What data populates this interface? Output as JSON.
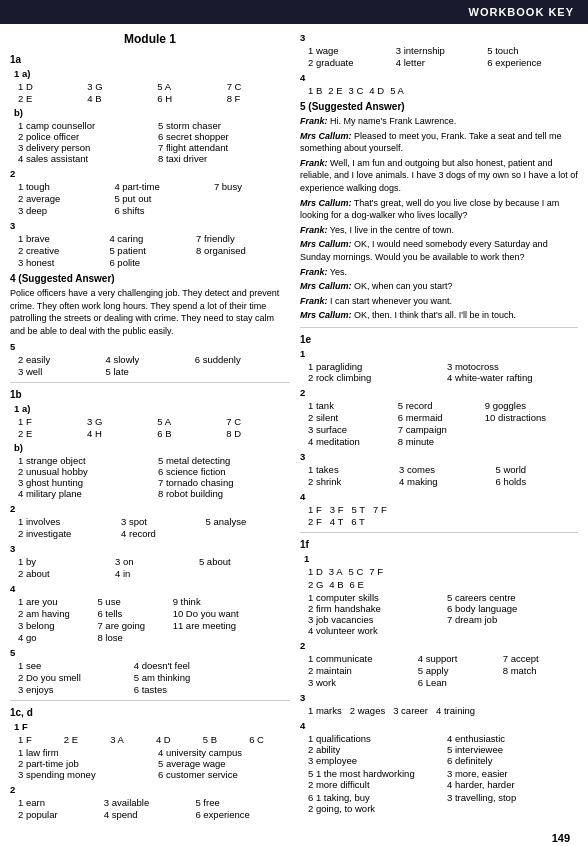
{
  "header": {
    "title": "WORKBOOK KEY"
  },
  "page_number": "149",
  "module": {
    "title": "Module 1"
  },
  "sections": {
    "1a": {
      "label": "1a",
      "q1": {
        "a": [
          "1 D",
          "3 G",
          "5 A",
          "7 C",
          "2 E",
          "4 B",
          "6 H",
          "8 F"
        ],
        "b": [
          "1 camp counsellor",
          "5 storm chaser",
          "2 police officer",
          "6 secret shopper",
          "3 delivery person",
          "7 flight attendant",
          "4 sales assistant",
          "8 taxi driver"
        ]
      },
      "q2": [
        "1 tough",
        "4 part-time",
        "7 busy",
        "2 average",
        "5 put out",
        "3 deep",
        "6 shifts"
      ],
      "q3": [
        "1 brave",
        "4 caring",
        "7 friendly",
        "2 creative",
        "5 patient",
        "8 organised",
        "3 honest",
        "6 polite"
      ],
      "q4_suggested": {
        "label": "4 (Suggested Answer)",
        "text": "Police officers have a very challenging job. They detect and prevent crime. They often work long hours. They spend a lot of their time patrolling the streets or dealing with crime. They need to stay calm and be able to deal with the public easily."
      },
      "q5": [
        "2 easily",
        "4 slowly",
        "6 suddenly",
        "3 well",
        "5 late"
      ]
    },
    "1b": {
      "label": "1b",
      "q1": {
        "a": [
          "1 F",
          "3 G",
          "5 A",
          "7 C",
          "2 E",
          "4 H",
          "6 B",
          "8 D"
        ],
        "b": [
          "1 strange object",
          "5 metal detecting",
          "2 unusual hobby",
          "6 science fiction",
          "3 ghost hunting",
          "7 tornado chasing",
          "4 military plane",
          "8 robot building"
        ]
      },
      "q2": [
        "1 involves",
        "3 spot",
        "5 analyse",
        "2 investigate",
        "4 record"
      ],
      "q3": [
        "1 by",
        "3 on",
        "5 about",
        "2 about",
        "4 in"
      ],
      "q4": [
        "1 are you",
        "5 use",
        "9 think",
        "2 am having",
        "6 tells",
        "10 Do you want",
        "3 belong",
        "7 are going",
        "11 are meeting",
        "4 go",
        "8 lose"
      ],
      "q5": [
        "1 see",
        "4 doesn't feel",
        "2 Do you smell",
        "5 am thinking",
        "3 enjoys",
        "6 tastes"
      ]
    },
    "1cd": {
      "label": "1c, d",
      "q1": {
        "a": [
          "1 F",
          "2 E",
          "3 A",
          "4 D",
          "5 B",
          "6 C"
        ],
        "b": [
          "1 law firm",
          "4 university campus",
          "2 part-time job",
          "5 average wage",
          "3 spending money",
          "6 customer service"
        ]
      },
      "q2": [
        "1 earn",
        "3 available",
        "5 free",
        "2 popular",
        "4 spend",
        "6 experience"
      ]
    }
  },
  "right_sections": {
    "q3_top": {
      "items": [
        "1 wage",
        "3 internship",
        "5 touch",
        "2 graduate",
        "4 letter",
        "6 experience"
      ]
    },
    "q4_top": {
      "items": [
        "1 B",
        "2 E",
        "3 C",
        "4 D",
        "5 A"
      ]
    },
    "q5_suggested": {
      "label": "5 (Suggested Answer)",
      "dialogue": [
        {
          "speaker": "Frank",
          "text": "Hi. My name's Frank Lawrence."
        },
        {
          "speaker": "Mrs Callum",
          "text": "Pleased to meet you, Frank. Take a seat and tell me something about yourself."
        },
        {
          "speaker": "Frank",
          "text": "Well, I am fun and outgoing but also honest, patient and reliable, and I love animals. I have 3 dogs of my own so I have a lot of experience walking dogs."
        },
        {
          "speaker": "Mrs Callum",
          "text": "That's great, well do you live close by because I am looking for a dog-walker who lives locally?"
        },
        {
          "speaker": "Frank",
          "text": "Yes, I live in the centre of town."
        },
        {
          "speaker": "Mrs Callum",
          "text": "OK, I would need somebody every Saturday and Sunday mornings. Would you be available to work then?"
        },
        {
          "speaker": "Frank",
          "text": "Yes."
        },
        {
          "speaker": "Mrs Callum",
          "text": "OK, when can you start?"
        },
        {
          "speaker": "Frank",
          "text": "I can start whenever you want."
        },
        {
          "speaker": "Mrs Callum",
          "text": "OK, then. I think that's all. I'll be in touch."
        }
      ]
    },
    "1e": {
      "label": "1e",
      "q1": [
        "1 paragliding",
        "3 motocross",
        "2 rock climbing",
        "4 white-water rafting"
      ],
      "q2": [
        "1 tank",
        "5 record",
        "9 goggles",
        "2 silent",
        "6 mermaid",
        "10 distractions",
        "3 surface",
        "7 campaign",
        "4 meditation",
        "8 minute"
      ],
      "q3": [
        "1 takes",
        "3 comes",
        "5 world",
        "2 shrink",
        "4 making",
        "6 holds"
      ],
      "q4": {
        "row1": [
          "1 F",
          "3 F",
          "5 T",
          "7 F"
        ],
        "row2": [
          "2 F",
          "4 T",
          "6 T"
        ]
      }
    },
    "1f": {
      "label": "1f",
      "q1": {
        "a": [
          "1 D",
          "3 A",
          "5 C",
          "7 F",
          "2 G",
          "4 B",
          "6 E"
        ],
        "b": [
          "1 computer skills",
          "5 careers centre",
          "2 firm handshake",
          "6 body language",
          "3 job vacancies",
          "7 dream job",
          "4 volunteer work"
        ]
      },
      "q2": [
        "1 communicate",
        "4 support",
        "7 accept",
        "2 maintain",
        "5 apply",
        "8 match",
        "3 work",
        "6 Lean"
      ],
      "q3": [
        "1 marks",
        "2 wages",
        "3 career",
        "4 training"
      ],
      "q4": {
        "a": [
          "1 qualifications",
          "4 enthusiastic",
          "2 ability",
          "5 interviewee",
          "3 employee",
          "6 definitely"
        ],
        "b": [
          "5 1 the most hardworking",
          "3 more, easier",
          "2 more difficult",
          "4 harder, harder"
        ],
        "c": [
          "6 1 taking, buy",
          "3 travelling, stop",
          "2 going, to work"
        ]
      }
    }
  }
}
